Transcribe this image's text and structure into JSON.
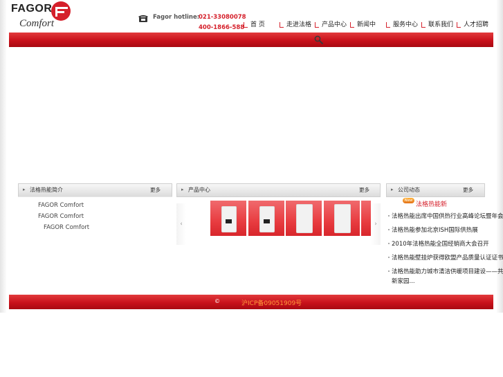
{
  "brand": {
    "name": "FAGOR",
    "sub": "Comfort"
  },
  "hotline": {
    "label": "Fagor hotline:",
    "number1": "021-33080078",
    "number2": "400-1866-588"
  },
  "nav": [
    {
      "label": "首  页"
    },
    {
      "label": "走进法格"
    },
    {
      "label": "产品中心"
    },
    {
      "label": "新闻中"
    },
    {
      "label": "服务中心"
    },
    {
      "label": "联系我们"
    },
    {
      "label": "人才招聘"
    }
  ],
  "panels": {
    "intro": {
      "title": "法格热能简介",
      "more": "更多",
      "lines": [
        "FAGOR Comfort",
        "FAGOR Comfort",
        "FAGOR Comfort"
      ]
    },
    "products": {
      "title": "产品中心",
      "more": "更多",
      "prev": "‹",
      "next": "›"
    },
    "news": {
      "title": "公司动态",
      "more": "更多",
      "badge": "New",
      "headline": "法格热能新",
      "items": [
        "法格热能出席中国供热行业高峰论坛暨年会",
        "法格热能参加北京ISH国际供热展",
        "2010年法格热能全国经销商大会召开",
        "法格热能壁挂炉获得欧盟产品质量认证证书",
        "法格热能助力城市清洁供暖项目建设——共建绿色",
        "新家园..."
      ]
    }
  },
  "footer": {
    "copyright": "©",
    "icp": "沪ICP备09051909号"
  },
  "colors": {
    "brand_red": "#d5202b",
    "footer_link": "#ff9a3a"
  }
}
